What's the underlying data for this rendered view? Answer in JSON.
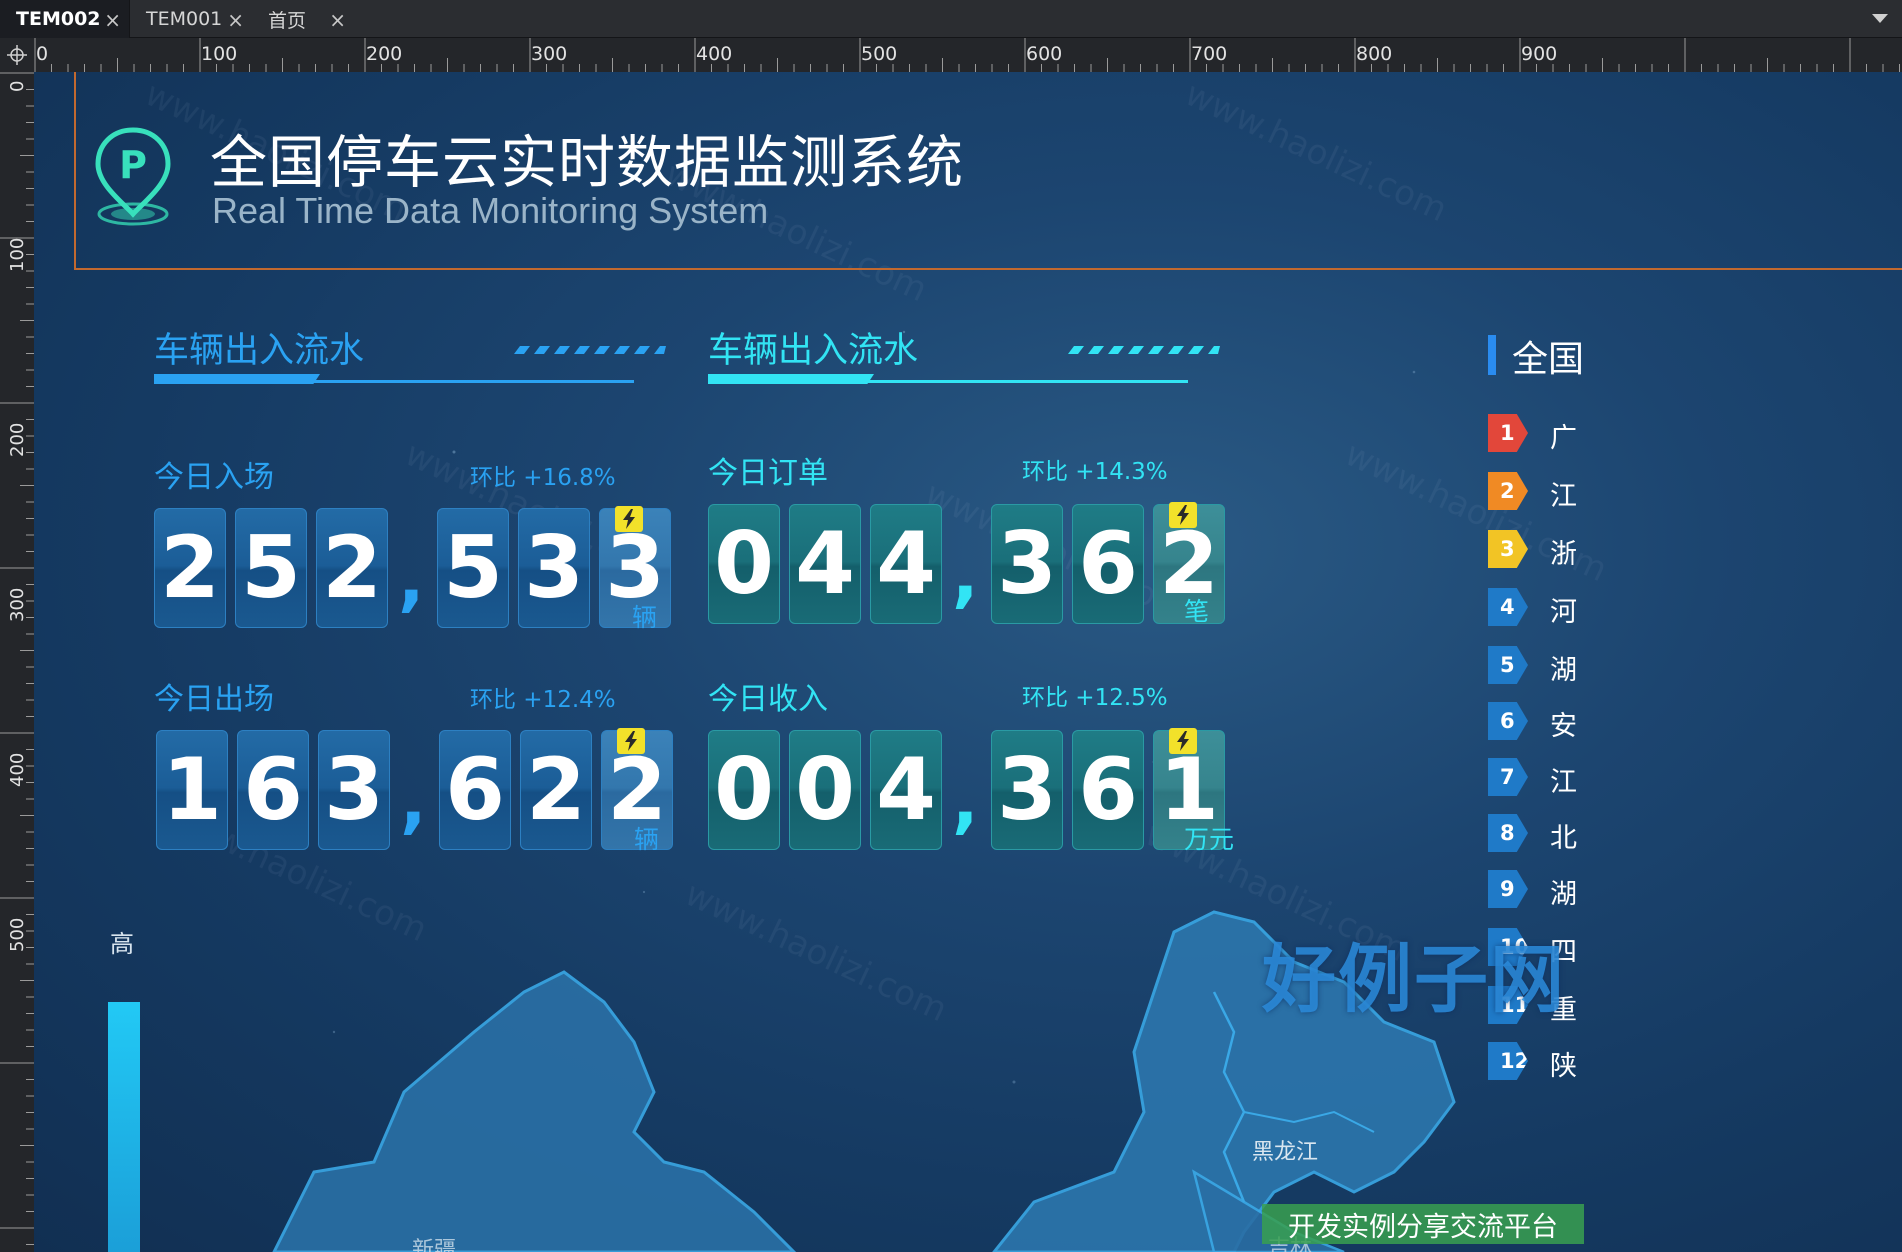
{
  "tabs": [
    {
      "label": "TEM002",
      "active": true
    },
    {
      "label": "TEM001",
      "active": false
    },
    {
      "label": "首页",
      "active": false
    }
  ],
  "tab_close_glyph": "×",
  "ruler": {
    "top_labels": [
      "0",
      "100",
      "200",
      "300",
      "400",
      "500",
      "600",
      "700",
      "800",
      "900"
    ],
    "left_labels": [
      "0",
      "100",
      "200",
      "300",
      "400",
      "500"
    ]
  },
  "header": {
    "title_cn": "全国停车云实时数据监测系统",
    "title_en": "Real Time Data Monitoring System",
    "logo_icon": "parking-pin-icon"
  },
  "sections": [
    {
      "title": "车辆出入流水",
      "color": "#2aa2f2"
    },
    {
      "title": "车辆出入流水",
      "color": "#32e4f4"
    }
  ],
  "stats": {
    "entry": {
      "label": "今日入场",
      "change": "环比 +16.8%",
      "digits": [
        "2",
        "5",
        "2",
        ",",
        "5",
        "3",
        "3"
      ],
      "unit": "辆"
    },
    "exit": {
      "label": "今日出场",
      "change": "环比 +12.4%",
      "digits": [
        "1",
        "6",
        "3",
        ",",
        "6",
        "2",
        "2"
      ],
      "unit": "辆"
    },
    "orders": {
      "label": "今日订单",
      "change": "环比 +14.3%",
      "digits": [
        "0",
        "4",
        "4",
        ",",
        "3",
        "6",
        "2"
      ],
      "unit": "笔"
    },
    "revenue": {
      "label": "今日收入",
      "change": "环比 +12.5%",
      "digits": [
        "0",
        "0",
        "4",
        ",",
        "3",
        "6",
        "1"
      ],
      "unit": "万元"
    }
  },
  "legend": {
    "high_label": "高"
  },
  "ranking": {
    "title": "全国",
    "items": [
      {
        "rank": "1",
        "name": "广",
        "color": "#e2473a"
      },
      {
        "rank": "2",
        "name": "江",
        "color": "#f08a24"
      },
      {
        "rank": "3",
        "name": "浙",
        "color": "#f2c425"
      },
      {
        "rank": "4",
        "name": "河",
        "color": "#1f7ac8"
      },
      {
        "rank": "5",
        "name": "湖",
        "color": "#1f7ac8"
      },
      {
        "rank": "6",
        "name": "安",
        "color": "#1f7ac8"
      },
      {
        "rank": "7",
        "name": "江",
        "color": "#1f7ac8"
      },
      {
        "rank": "8",
        "name": "北",
        "color": "#1f7ac8"
      },
      {
        "rank": "9",
        "name": "湖",
        "color": "#1f7ac8"
      },
      {
        "rank": "10",
        "name": "四",
        "color": "#1f7ac8"
      },
      {
        "rank": "11",
        "name": "重",
        "color": "#1f7ac8"
      },
      {
        "rank": "12",
        "name": "陕",
        "color": "#1f7ac8"
      }
    ]
  },
  "map": {
    "labels": [
      "黑龙江",
      "吉林",
      "新疆"
    ]
  },
  "watermark": {
    "main": "好例子网",
    "sub": "开发实例分享交流平台",
    "tile": "www.haolizi.com"
  },
  "colors": {
    "accent_blue": "#2aa2f2",
    "accent_cyan": "#32e4f4",
    "header_border": "#c2692f",
    "bolt": "#f2e12a"
  }
}
